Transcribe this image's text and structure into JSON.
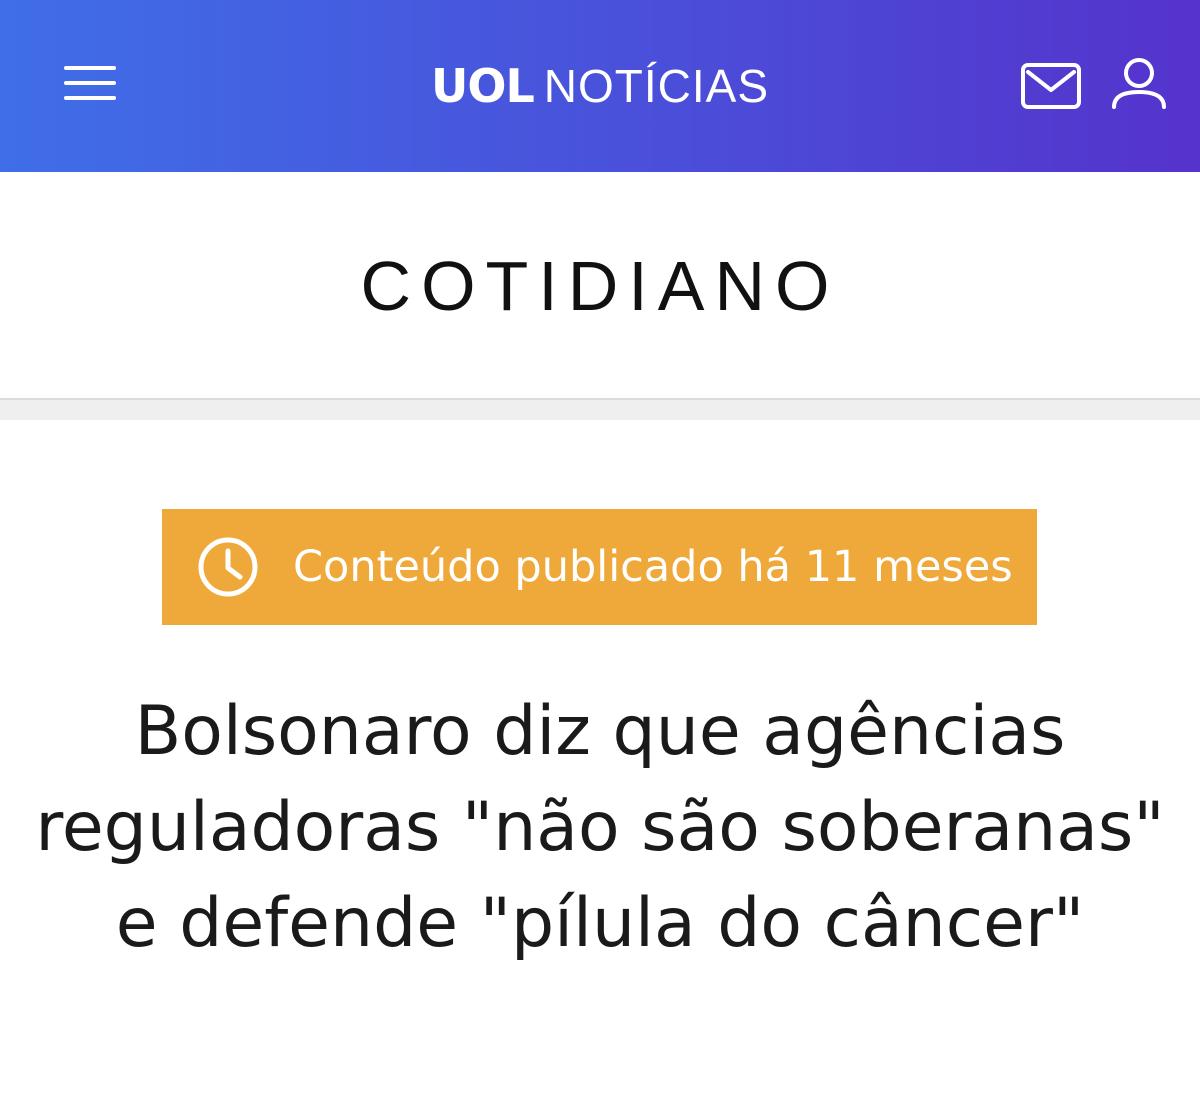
{
  "header": {
    "logo_text": "UOL",
    "section_label": "NOTÍCIAS",
    "menu_icon": "hamburger-menu-icon",
    "mail_icon": "mail-icon",
    "user_icon": "user-icon",
    "gradient_colors": [
      "#3f6ee8",
      "#5533cc"
    ]
  },
  "section": {
    "title": "COTIDIANO"
  },
  "article": {
    "age_notice": "Conteúdo publicado há 11 meses",
    "age_notice_icon": "clock-icon",
    "age_notice_color": "#efa93b",
    "headline": "Bolsonaro diz que agências reguladoras \"não são soberanas\" e defende \"pílula do câncer\""
  }
}
